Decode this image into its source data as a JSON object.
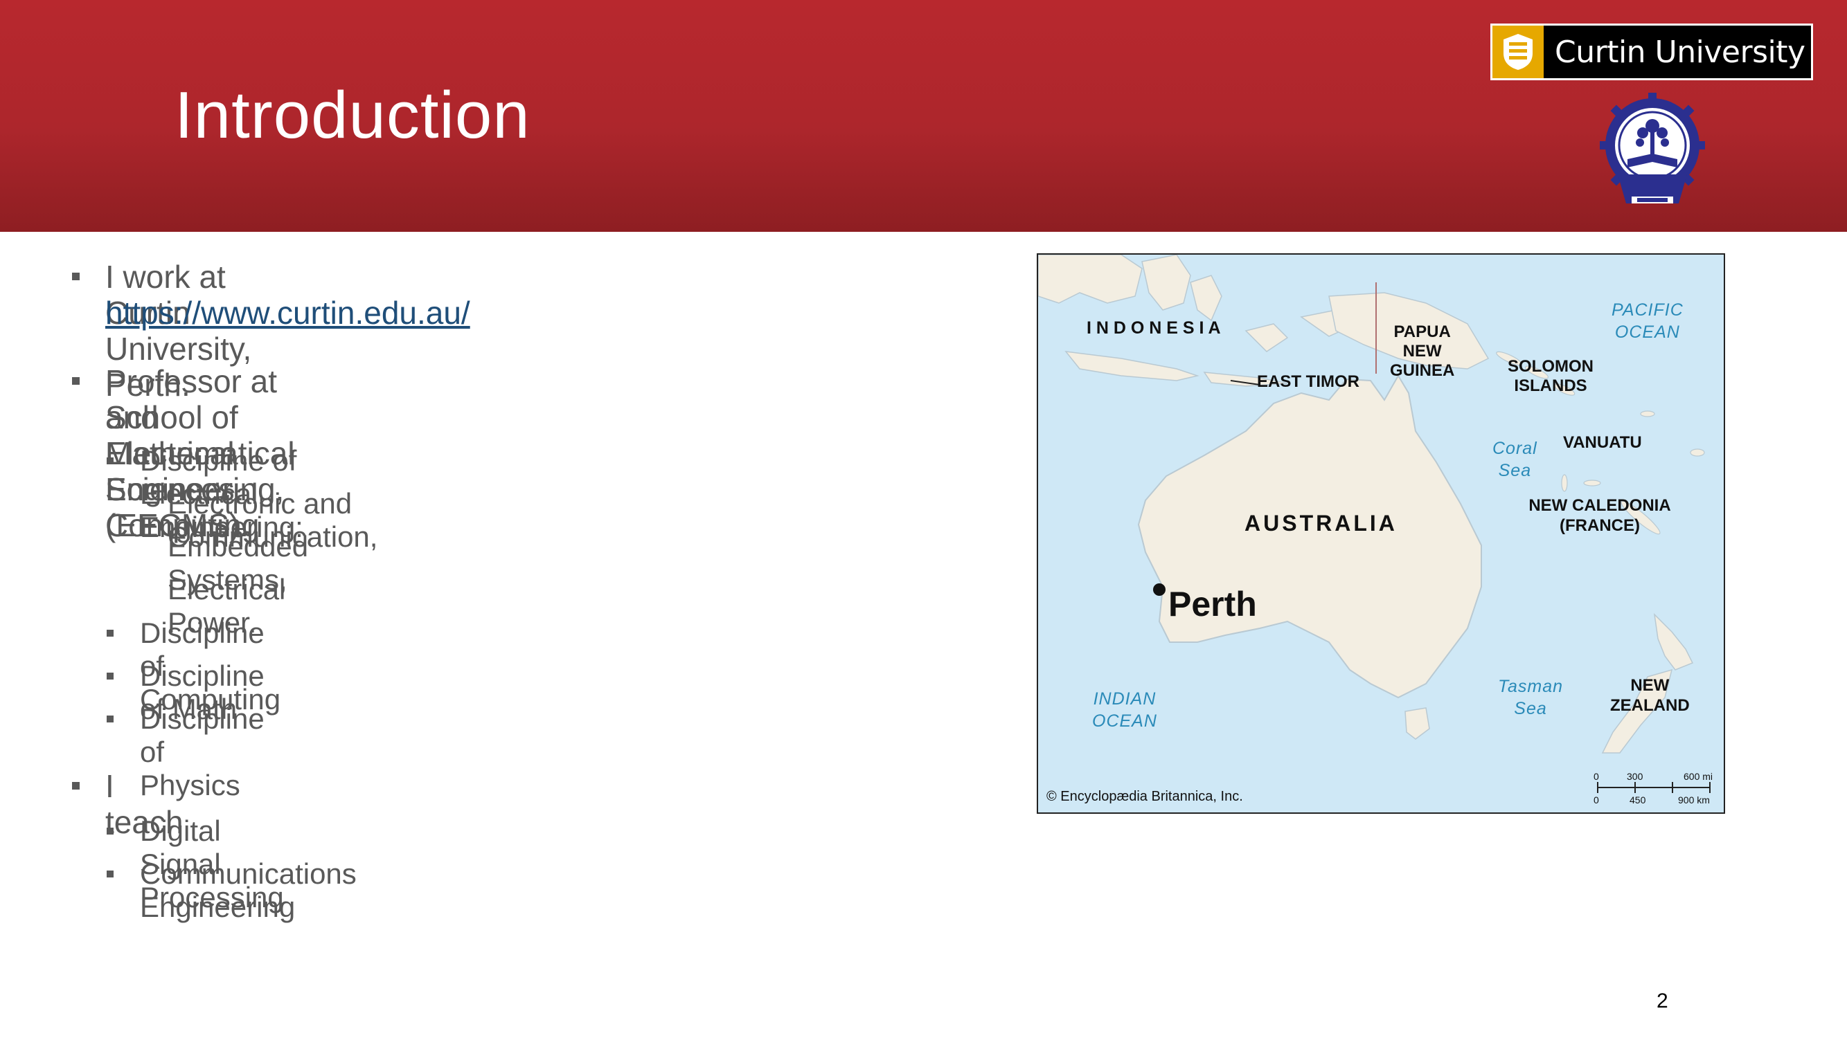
{
  "slide": {
    "title": "Introduction",
    "page_number": "2"
  },
  "logos": {
    "curtin_name": "Curtin University"
  },
  "bullets": {
    "work": "I work at Curtin University, Perth.",
    "work_link": "https://www.curtin.edu.au/",
    "professor_line1": "Professor at School of Electrical Engineering, Computing",
    "professor_line2": "and Mathematical Sciences (EECMS).",
    "disc_elec": "Discipline of Electrical Engineering:",
    "elec_sub1": "Electronic and Communication,",
    "elec_sub2": "Embedded Systems,",
    "elec_sub3": "Electrical Power.",
    "disc_comp": "Discipline of Computing",
    "disc_math": "Discipline of Math",
    "disc_phys": "Discipline of Physics",
    "teach": "I teach",
    "teach_dsp": "Digital Signal Processing",
    "teach_comm": "Communications Engineering"
  },
  "map": {
    "indonesia": "I N D O N E S I A",
    "papua1": "PAPUA",
    "papua2": "NEW",
    "papua3": "GUINEA",
    "east_timor": "EAST TIMOR",
    "solomon1": "SOLOMON",
    "solomon2": "ISLANDS",
    "pacific1": "PACIFIC",
    "pacific2": "OCEAN",
    "coral1": "Coral",
    "coral2": "Sea",
    "vanuatu": "VANUATU",
    "new_caledonia1": "NEW CALEDONIA",
    "new_caledonia2": "(FRANCE)",
    "australia": "AUSTRALIA",
    "perth": "Perth",
    "indian1": "INDIAN",
    "indian2": "OCEAN",
    "tasman1": "Tasman",
    "tasman2": "Sea",
    "nz1": "NEW",
    "nz2": "ZEALAND",
    "copyright": "© Encyclopædia Britannica, Inc.",
    "scale_mi_0": "0",
    "scale_mi_1": "300",
    "scale_mi_2": "600 mi",
    "scale_km_0": "0",
    "scale_km_1": "450",
    "scale_km_2": "900 km"
  },
  "colors": {
    "header_red": "#b8282e",
    "text_gray": "#595959",
    "link_blue": "#1f4e79",
    "ocean": "#cfe8f6",
    "land": "#f3eee2",
    "ocean_label": "#2a8ab8"
  }
}
